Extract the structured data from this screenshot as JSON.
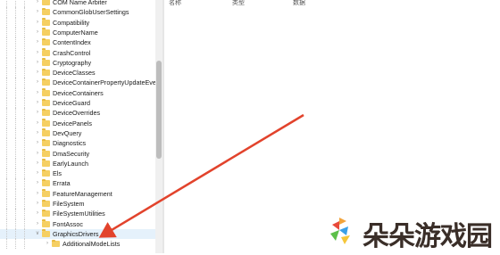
{
  "list_header": {
    "name": "名称",
    "type": "类型",
    "data": "数据"
  },
  "tree": {
    "items": [
      {
        "label": "COM Name Arbiter",
        "depth": 0,
        "expanded": false,
        "selected": false
      },
      {
        "label": "CommonGlobUserSettings",
        "depth": 0,
        "expanded": false,
        "selected": false
      },
      {
        "label": "Compatibility",
        "depth": 0,
        "expanded": false,
        "selected": false
      },
      {
        "label": "ComputerName",
        "depth": 0,
        "expanded": false,
        "selected": false
      },
      {
        "label": "ContentIndex",
        "depth": 0,
        "expanded": false,
        "selected": false
      },
      {
        "label": "CrashControl",
        "depth": 0,
        "expanded": false,
        "selected": false
      },
      {
        "label": "Cryptography",
        "depth": 0,
        "expanded": false,
        "selected": false
      },
      {
        "label": "DeviceClasses",
        "depth": 0,
        "expanded": false,
        "selected": false
      },
      {
        "label": "DeviceContainerPropertyUpdateEve",
        "depth": 0,
        "expanded": false,
        "selected": false
      },
      {
        "label": "DeviceContainers",
        "depth": 0,
        "expanded": false,
        "selected": false
      },
      {
        "label": "DeviceGuard",
        "depth": 0,
        "expanded": false,
        "selected": false
      },
      {
        "label": "DeviceOverrides",
        "depth": 0,
        "expanded": false,
        "selected": false
      },
      {
        "label": "DevicePanels",
        "depth": 0,
        "expanded": false,
        "selected": false
      },
      {
        "label": "DevQuery",
        "depth": 0,
        "expanded": false,
        "selected": false
      },
      {
        "label": "Diagnostics",
        "depth": 0,
        "expanded": false,
        "selected": false
      },
      {
        "label": "DmaSecurity",
        "depth": 0,
        "expanded": false,
        "selected": false
      },
      {
        "label": "EarlyLaunch",
        "depth": 0,
        "expanded": false,
        "selected": false
      },
      {
        "label": "Els",
        "depth": 0,
        "expanded": false,
        "selected": false
      },
      {
        "label": "Errata",
        "depth": 0,
        "expanded": false,
        "selected": false
      },
      {
        "label": "FeatureManagement",
        "depth": 0,
        "expanded": false,
        "selected": false
      },
      {
        "label": "FileSystem",
        "depth": 0,
        "expanded": false,
        "selected": false
      },
      {
        "label": "FileSystemUtilities",
        "depth": 0,
        "expanded": false,
        "selected": false
      },
      {
        "label": "FontAssoc",
        "depth": 0,
        "expanded": false,
        "selected": false
      },
      {
        "label": "GraphicsDrivers",
        "depth": 0,
        "expanded": true,
        "selected": true
      },
      {
        "label": "AdditionalModeLists",
        "depth": 1,
        "expanded": false,
        "selected": false
      }
    ]
  },
  "annotation": {
    "color": "#e2432c"
  },
  "watermark": {
    "text": "朵朵游戏园"
  }
}
